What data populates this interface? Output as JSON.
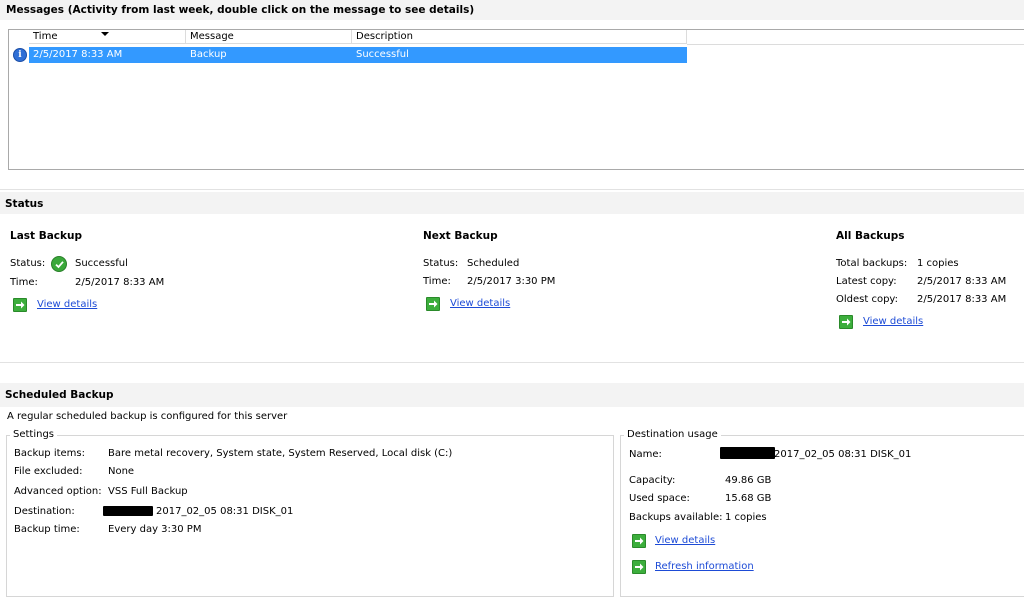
{
  "messages": {
    "title": "Messages (Activity from last week, double click on the message to see details)",
    "columns": [
      "Time",
      "Message",
      "Description"
    ],
    "rows": [
      {
        "time": "2/5/2017 8:33 AM",
        "message": "Backup",
        "description": "Successful",
        "icon": "info-icon"
      }
    ]
  },
  "status": {
    "title": "Status",
    "last_backup": {
      "title": "Last Backup",
      "status_label": "Status:",
      "status_value": "Successful",
      "status_icon": "check-circle-icon",
      "time_label": "Time:",
      "time_value": "2/5/2017 8:33 AM",
      "link": "View details"
    },
    "next_backup": {
      "title": "Next Backup",
      "status_label": "Status:",
      "status_value": "Scheduled",
      "time_label": "Time:",
      "time_value": "2/5/2017 3:30 PM",
      "link": "View details"
    },
    "all_backups": {
      "title": "All Backups",
      "total_label": "Total backups:",
      "total_value": "1 copies",
      "latest_label": "Latest copy:",
      "latest_value": "2/5/2017 8:33 AM",
      "oldest_label": "Oldest copy:",
      "oldest_value": "2/5/2017 8:33 AM",
      "link": "View details"
    }
  },
  "scheduled": {
    "title": "Scheduled Backup",
    "summary": "A regular scheduled backup is configured for this server",
    "settings": {
      "title": "Settings",
      "items_label": "Backup items:",
      "items_value": "Bare metal recovery, System state, System Reserved, Local disk (C:)",
      "excluded_label": "File excluded:",
      "excluded_value": "None",
      "advanced_label": "Advanced option:",
      "advanced_value": "VSS Full Backup",
      "destination_label": "Destination:",
      "destination_value": "2017_02_05 08:31 DISK_01",
      "time_label": "Backup time:",
      "time_value": "Every day 3:30 PM"
    },
    "destination_usage": {
      "title": "Destination usage",
      "name_label": "Name:",
      "name_value": "2017_02_05 08:31 DISK_01",
      "capacity_label": "Capacity:",
      "capacity_value": "49.86 GB",
      "used_label": "Used space:",
      "used_value": "15.68 GB",
      "available_label": "Backups available:",
      "available_value": "1 copies",
      "link_details": "View details",
      "link_refresh": "Refresh information"
    }
  },
  "colors": {
    "selection": "#3399ff",
    "link": "#1d4bd6",
    "arrow_green": "#3cae3c",
    "band": "#f3f3f3"
  }
}
